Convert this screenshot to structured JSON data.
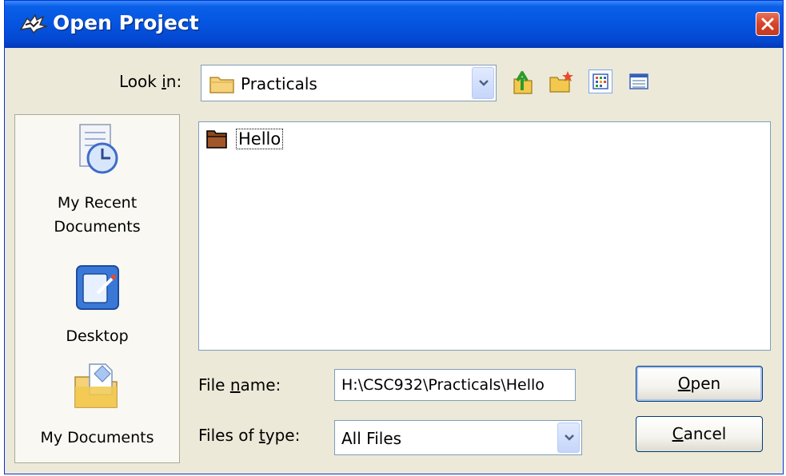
{
  "window": {
    "title": "Open Project",
    "close_label": "×"
  },
  "toolbar": {
    "look_in_label_pre": "Look ",
    "look_in_label_key": "i",
    "look_in_label_post": "n:",
    "look_in_value": "Practicals",
    "icons": [
      "up-one-level-icon",
      "create-new-folder-icon",
      "list-view-icon",
      "details-view-icon"
    ],
    "selected_view": "list-view-icon"
  },
  "places": [
    {
      "line1": "My Recent",
      "line2": "Documents",
      "icon": "recent-documents-icon"
    },
    {
      "line1": "Desktop",
      "line2": "",
      "icon": "desktop-icon"
    },
    {
      "line1": "My Documents",
      "line2": "",
      "icon": "my-documents-icon"
    }
  ],
  "files": [
    {
      "name": "Hello",
      "icon": "folder-icon",
      "focused": true
    }
  ],
  "form": {
    "file_name_label_pre": "File ",
    "file_name_label_key": "n",
    "file_name_label_post": "ame:",
    "file_name_value": "H:\\CSC932\\Practicals\\Hello",
    "file_type_label_pre": "Files of ",
    "file_type_label_key": "t",
    "file_type_label_post": "ype:",
    "file_type_value": "All Files"
  },
  "buttons": {
    "open_key": "O",
    "open_rest": "pen",
    "cancel_key": "C",
    "cancel_rest": "ancel"
  },
  "colors": {
    "titlebar": "#0554e0",
    "dialog_bg": "#ece9d8",
    "close_button": "#d6432a",
    "field_border": "#7f9db9"
  }
}
